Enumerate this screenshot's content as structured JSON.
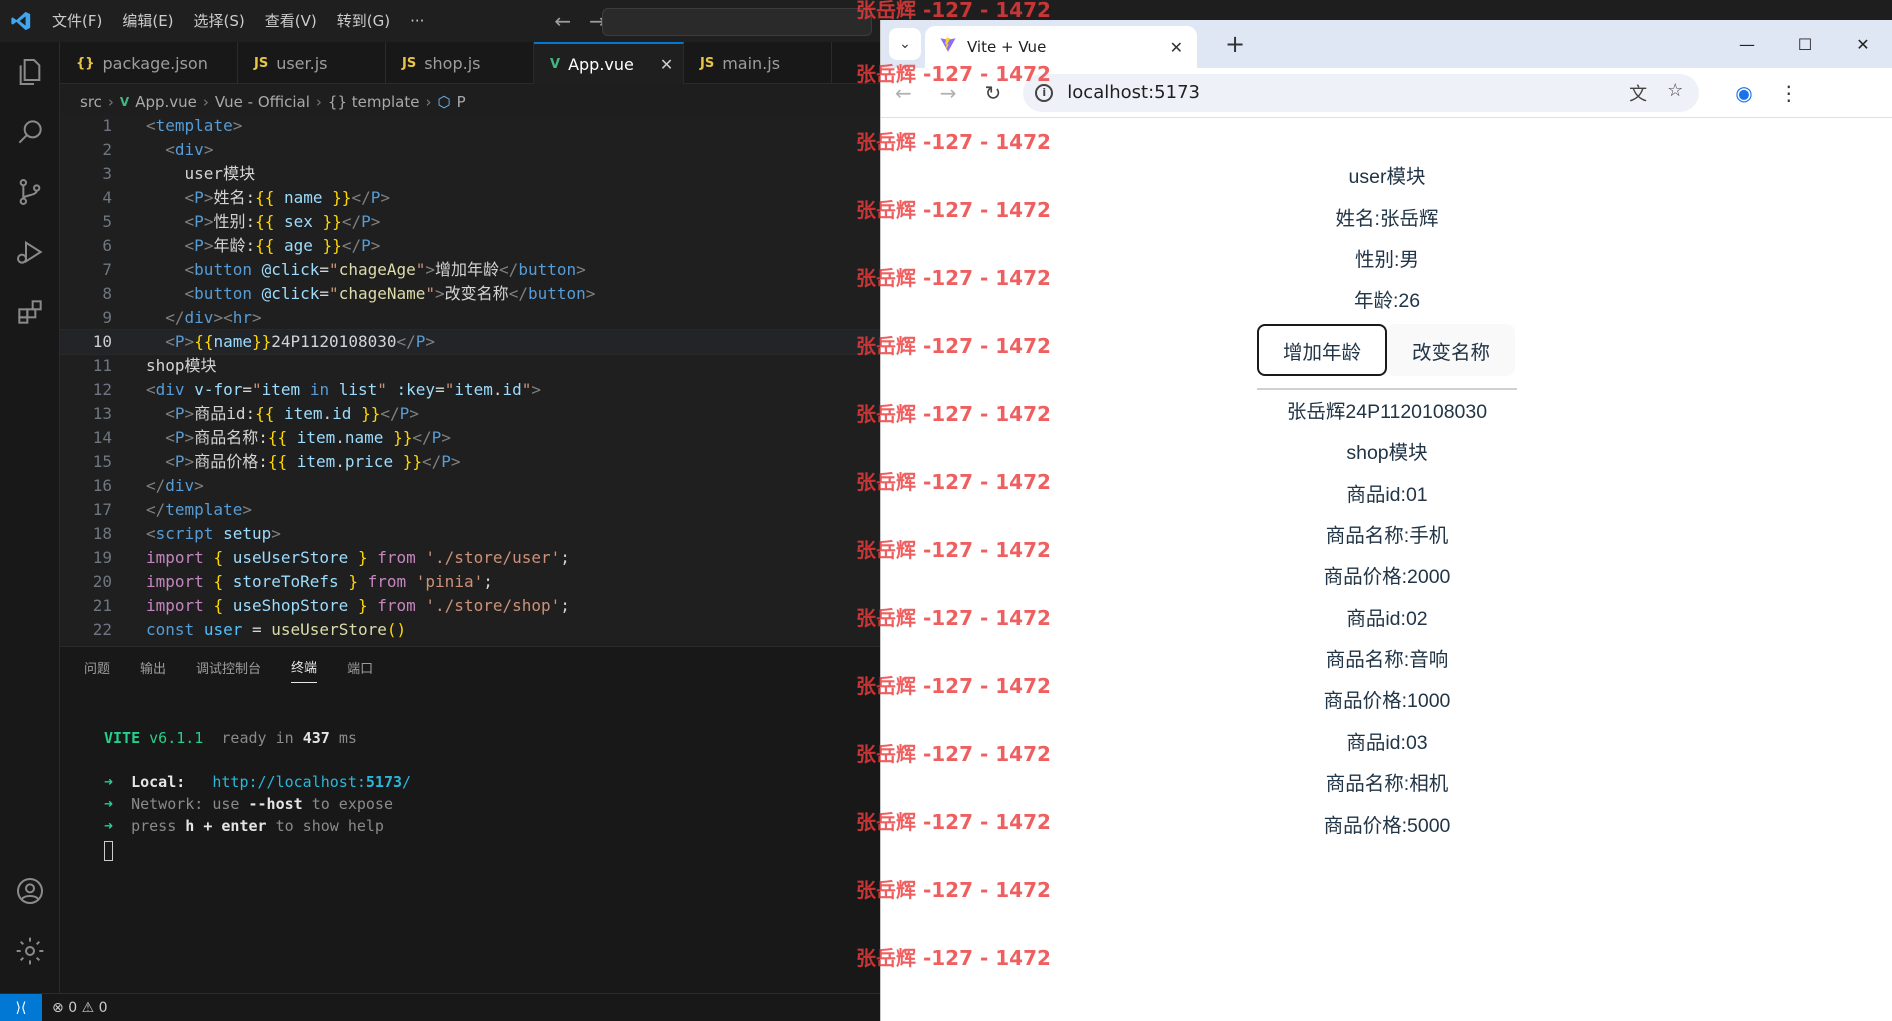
{
  "vscode": {
    "menu": [
      "文件(F)",
      "编辑(E)",
      "选择(S)",
      "查看(V)",
      "转到(G)",
      "···"
    ],
    "tabs": [
      {
        "label": "package.json",
        "icon": "{}",
        "kind": "json"
      },
      {
        "label": "user.js",
        "icon": "JS",
        "kind": "js"
      },
      {
        "label": "shop.js",
        "icon": "JS",
        "kind": "js"
      },
      {
        "label": "App.vue",
        "icon": "V",
        "kind": "vue",
        "active": true
      },
      {
        "label": "main.js",
        "icon": "JS",
        "kind": "js"
      }
    ],
    "breadcrumb": [
      "src",
      "App.vue",
      "Vue - Official",
      "{} template",
      "P"
    ],
    "code_lines": [
      "1",
      "2",
      "3",
      "4",
      "5",
      "6",
      "7",
      "8",
      "9",
      "10",
      "11",
      "12",
      "13",
      "14",
      "15",
      "16",
      "17",
      "18",
      "19",
      "20",
      "21",
      "22"
    ],
    "panel_tabs": [
      "问题",
      "输出",
      "调试控制台",
      "终端",
      "端口"
    ],
    "active_panel_tab": "终端",
    "terminal": {
      "vite": "VITE",
      "version": "v6.1.1",
      "ready": "ready in",
      "ms_value": "437",
      "ms": "ms",
      "local_label": "Local:",
      "local_url_pre": "http://localhost:",
      "local_port": "5173",
      "local_url_post": "/",
      "network_label": "Network:",
      "network_text1": "use",
      "network_flag": "--host",
      "network_text2": "to expose",
      "press": "press",
      "keys": "h + enter",
      "help": "to show help"
    },
    "status": {
      "errors": "0",
      "warnings": "0"
    }
  },
  "browser": {
    "tab_title": "Vite + Vue",
    "url": "localhost:5173",
    "page": {
      "user_module": "user模块",
      "name": "姓名:张岳辉",
      "sex": "性别:男",
      "age": "年龄:26",
      "btn_age": "增加年龄",
      "btn_name": "改变名称",
      "name_id": "张岳辉24P1120108030",
      "shop_module": "shop模块",
      "items": [
        {
          "id": "商品id:01",
          "name": "商品名称:手机",
          "price": "商品价格:2000"
        },
        {
          "id": "商品id:02",
          "name": "商品名称:音响",
          "price": "商品价格:1000"
        },
        {
          "id": "商品id:03",
          "name": "商品名称:相机",
          "price": "商品价格:5000"
        }
      ]
    }
  },
  "watermark": "张岳辉 -127 - 1472",
  "colors": {
    "accent": "#0078d4",
    "vite_green": "#23d18b",
    "watermark": "#eb3c3c"
  }
}
